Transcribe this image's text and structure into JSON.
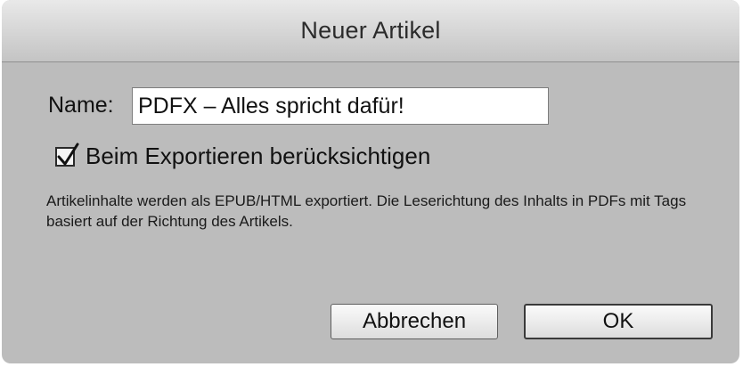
{
  "dialog": {
    "title": "Neuer Artikel",
    "name_label": "Name:",
    "name_value": "PDFX – Alles spricht dafür!",
    "checkbox": {
      "label": "Beim Exportieren berücksichtigen",
      "checked": true
    },
    "description": "Artikelinhalte werden als EPUB/HTML exportiert. Die Leserichtung des Inhalts in PDFs mit Tags basiert auf der Richtung des Artikels.",
    "buttons": {
      "cancel_label": "Abbrechen",
      "ok_label": "OK"
    }
  }
}
